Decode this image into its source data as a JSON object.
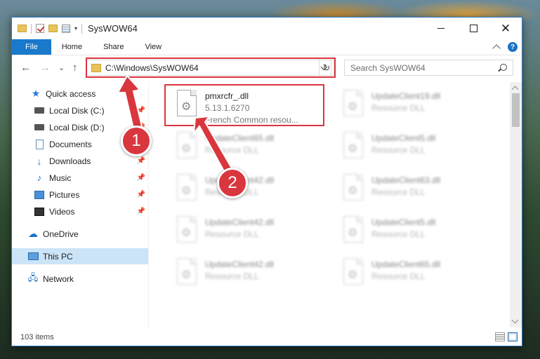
{
  "window": {
    "title": "SysWOW64",
    "controls": {
      "minimize": "",
      "maximize": "",
      "close": "✕"
    }
  },
  "ribbon": {
    "tabs": [
      "File",
      "Home",
      "Share",
      "View"
    ],
    "help": "?"
  },
  "address": {
    "path": "C:\\Windows\\SysWOW64",
    "refresh": "↻",
    "search_placeholder": "Search SysWOW64"
  },
  "nav": {
    "back": "←",
    "forward": "→",
    "recent": "⌄",
    "up": "↑"
  },
  "sidebar": {
    "items": [
      {
        "label": "Quick access",
        "icon": "star-icon"
      },
      {
        "label": "Local Disk (C:)",
        "icon": "disk-icon",
        "pinned": true
      },
      {
        "label": "Local Disk (D:)",
        "icon": "disk-icon",
        "pinned": true
      },
      {
        "label": "Documents",
        "icon": "document-icon",
        "pinned": true
      },
      {
        "label": "Downloads",
        "icon": "download-icon",
        "pinned": true
      },
      {
        "label": "Music",
        "icon": "music-icon",
        "pinned": true
      },
      {
        "label": "Pictures",
        "icon": "pictures-icon",
        "pinned": true
      },
      {
        "label": "Videos",
        "icon": "video-icon",
        "pinned": true
      },
      {
        "label": "OneDrive",
        "icon": "cloud-icon"
      },
      {
        "label": "This PC",
        "icon": "pc-icon",
        "active": true
      },
      {
        "label": "Network",
        "icon": "network-icon"
      }
    ]
  },
  "files": [
    {
      "name": "pmxrcfr_.dll",
      "line2": "5.13.1.6270",
      "line3": "French Common resou..."
    },
    {
      "name": "UpdateClient19.dll",
      "line2": "Resource DLL"
    },
    {
      "name": "UpdateClient65.dll",
      "line2": "Resource DLL"
    },
    {
      "name": "UpdateClient5.dll",
      "line2": "Resource DLL"
    },
    {
      "name": "UpdateClient42.dll",
      "line2": "Resource DLL"
    },
    {
      "name": "UpdateClient63.dll",
      "line2": "Resource DLL"
    },
    {
      "name": "UpdateClient42.dll",
      "line2": "Resource DLL"
    },
    {
      "name": "UpdateClient5.dll",
      "line2": "Resource DLL"
    },
    {
      "name": "UpdateClient42.dll",
      "line2": "Resource DLL"
    },
    {
      "name": "UpdateClient65.dll",
      "line2": "Resource DLL"
    }
  ],
  "status": {
    "item_count": "103 items"
  },
  "callouts": {
    "one": "1",
    "two": "2"
  },
  "colors": {
    "accent": "#1979ca",
    "highlight": "#d9363e",
    "selected": "#cce4f7"
  }
}
